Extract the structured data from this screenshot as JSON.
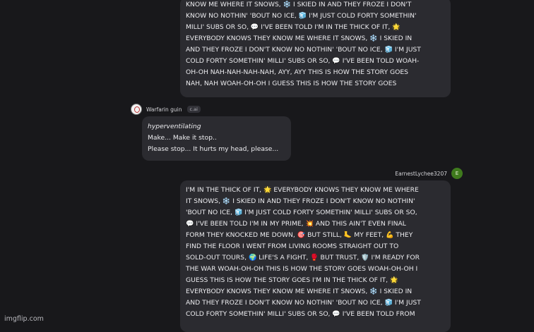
{
  "messages": [
    {
      "author": "user",
      "lines": [
        "KNOW ME WHERE IT SNOWS, ❄️ I SKIED IN AND THEY FROZE I DON'T",
        "KNOW NO NOTHIN' 'BOUT NO ICE, 🧊 I'M JUST COLD FORTY SOMETHIN'",
        "MILLI' SUBS OR SO, 💬 I'VE BEEN TOLD I'M IN THE THICK OF IT, 🌟",
        "EVERYBODY KNOWS THEY KNOW ME WHERE IT SNOWS, ❄️ I SKIED IN",
        "AND THEY FROZE I DON'T KNOW NO NOTHIN' 'BOUT NO ICE, 🧊 I'M JUST",
        "COLD FORTY SOMETHIN' MILLI' SUBS OR SO, 💬 I'VE BEEN TOLD WOAH-",
        "OH-OH NAH-NAH-NAH-NAH, AYY, AYY THIS IS HOW THE STORY GOES",
        "NAH, NAH WOAH-OH-OH I GUESS THIS IS HOW THE STORY GOES"
      ]
    },
    {
      "author": "bot",
      "name": "Warfarin guin",
      "tag": "c.ai",
      "lines": [
        "hyperventilating",
        "Make... Make it stop..",
        "Please stop... It hurts my head, please..."
      ]
    },
    {
      "author": "user",
      "name": "EarnestLychee3207",
      "avatar_letter": "E",
      "lines": [
        "I'M IN THE THICK OF IT, 🌟 EVERYBODY KNOWS THEY KNOW ME WHERE",
        "IT SNOWS, ❄️ I SKIED IN AND THEY FROZE I DON'T KNOW NO NOTHIN'",
        "'BOUT NO ICE, 🧊 I'M JUST COLD FORTY SOMETHIN' MILLI' SUBS OR SO,",
        "💬 I'VE BEEN TOLD I'M IN MY PRIME, 💥 AND THIS AIN'T EVEN FINAL",
        "FORM THEY KNOCKED ME DOWN, 🎯 BUT STILL, 🦶 MY FEET, 💪 THEY",
        "FIND THE FLOOR I WENT FROM LIVING ROOMS STRAIGHT OUT TO",
        "SOLD-OUT TOURS, 🌍 LIFE'S A FIGHT, 🥊 BUT TRUST, 🛡️ I'M READY FOR",
        "THE WAR WOAH-OH-OH THIS IS HOW THE STORY GOES WOAH-OH-OH I",
        "GUESS THIS IS HOW THE STORY GOES I'M IN THE THICK OF IT, 🌟",
        "EVERYBODY KNOWS THEY KNOW ME WHERE IT SNOWS, ❄️ I SKIED IN",
        "AND THEY FROZE I DON'T KNOW NO NOTHIN' 'BOUT NO ICE, 🧊 I'M JUST",
        "COLD FORTY SOMETHIN' MILLI' SUBS OR SO, 💬 I'VE BEEN TOLD FROM"
      ]
    }
  ],
  "watermark": "imgflip.com",
  "colors": {
    "background": "#18181b",
    "bubble": "#2b2b30",
    "user_avatar": "#3f7a1d"
  }
}
